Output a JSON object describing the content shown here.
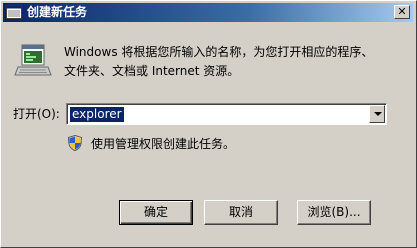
{
  "window": {
    "title": "创建新任务",
    "close_label": "✕"
  },
  "description": {
    "line1": "Windows 将根据您所输入的名称，为您打开相应的程序、",
    "line2": "文件夹、文档或 Internet 资源。"
  },
  "open": {
    "label": "打开(O):",
    "value": "explorer"
  },
  "admin_note": "使用管理权限创建此任务。",
  "buttons": {
    "ok": "确定",
    "cancel": "取消",
    "browse": "浏览(B)..."
  },
  "icons": {
    "title": "run-icon",
    "main": "run-program-icon",
    "shield": "uac-shield-icon"
  },
  "colors": {
    "title_bar_start": "#0a246a",
    "title_bar_end": "#a6caf0",
    "selection": "#0a246a",
    "dialog_bg": "#d4d0c8"
  }
}
